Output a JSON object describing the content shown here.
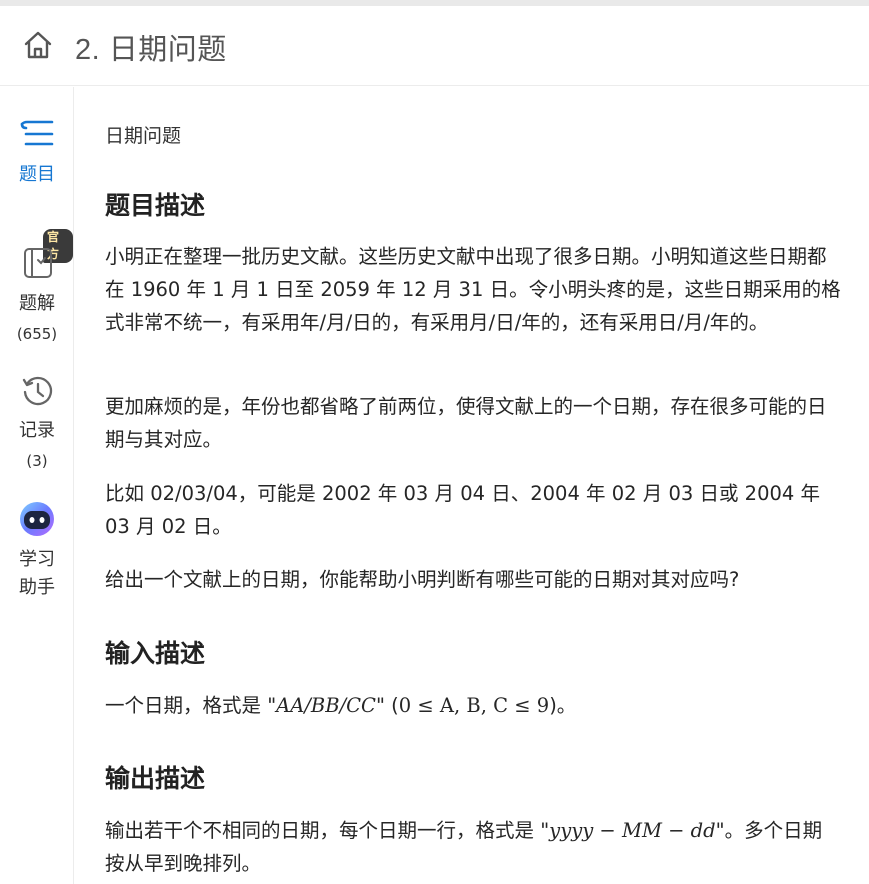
{
  "header": {
    "title": "2. 日期问题"
  },
  "sidebar": {
    "problem_label": "题目",
    "solution_badge": "官方",
    "solution_label": "题解",
    "solution_count": "(655)",
    "record_label": "记录",
    "record_count": "(3)",
    "assistant_label_line1": "学习",
    "assistant_label_line2": "助手"
  },
  "content": {
    "breadcrumb": "日期问题",
    "section_desc": "题目描述",
    "para1": "小明正在整理一批历史文献。这些历史文献中出现了很多日期。小明知道这些日期都在 1960 年 1 月 1 日至 2059 年 12 月 31 日。令小明头疼的是，这些日期采用的格式非常不统一，有采用年/月/日的，有采用月/日/年的，还有采用日/月/年的。",
    "para2": "更加麻烦的是，年份也都省略了前两位，使得文献上的一个日期，存在很多可能的日期与其对应。",
    "para3": "比如 02/03/04，可能是 2002 年 03 月 04 日、2004 年 02 月 03 日或 2004 年 03 月 02 日。",
    "para4": "给出一个文献上的日期，你能帮助小明判断有哪些可能的日期对其对应吗?",
    "section_input": "输入描述",
    "input_prefix": "一个日期，格式是 \"",
    "input_format": "AA/BB/CC",
    "input_mid": "\" (",
    "input_range": "0 ≤ A, B, C ≤ 9",
    "input_suffix": ")。",
    "section_output": "输出描述",
    "output_prefix": "输出若干个不相同的日期，每个日期一行，格式是 \"",
    "output_format": "yyyy − MM − dd",
    "output_suffix": "\"。多个日期按从早到晚排列。"
  }
}
